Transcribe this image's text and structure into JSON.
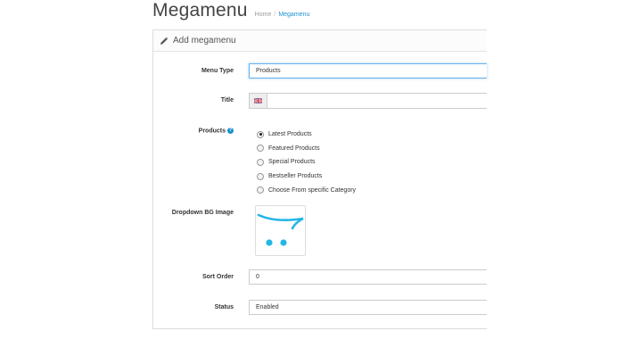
{
  "header": {
    "title": "Megamenu",
    "breadcrumb": [
      "Home",
      "Megamenu"
    ]
  },
  "panel": {
    "title": "Add megamenu",
    "title_icon": "pencil-icon"
  },
  "form": {
    "menu_type": {
      "label": "Menu Type",
      "value": "Products"
    },
    "title": {
      "label": "Title",
      "value": "",
      "language_icon": "uk-flag-icon"
    },
    "products": {
      "label": "Products",
      "help_icon": "help-icon",
      "options": [
        {
          "label": "Latest Products",
          "checked": true
        },
        {
          "label": "Featured Products",
          "checked": false
        },
        {
          "label": "Special Products",
          "checked": false
        },
        {
          "label": "Bestseller Products",
          "checked": false
        },
        {
          "label": "Choose From specific Category",
          "checked": false
        }
      ]
    },
    "dropdown_bg_image": {
      "label": "Dropdown BG Image",
      "image_icon": "opencart-cart-logo"
    },
    "sort_order": {
      "label": "Sort Order",
      "value": "0"
    },
    "status": {
      "label": "Status",
      "value": "Enabled"
    }
  },
  "colors": {
    "accent": "#1e91cf",
    "logo": "#23b6e6",
    "focus_border": "#66afe9"
  }
}
